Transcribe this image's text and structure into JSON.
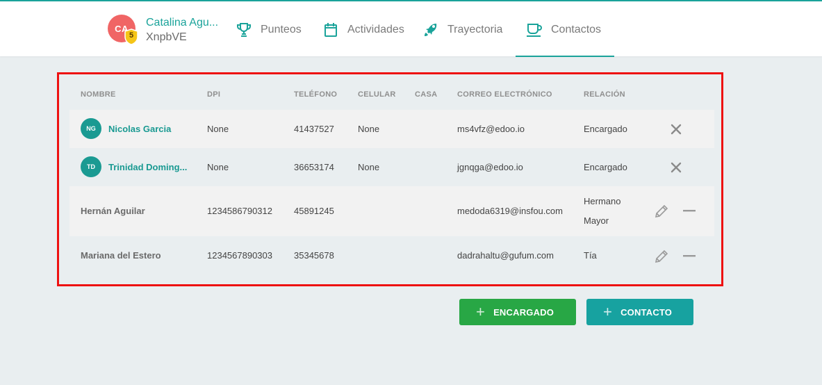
{
  "student": {
    "initials": "CA",
    "level": "5",
    "name": "Catalina Agu...",
    "code": "XnpbVE"
  },
  "nav": {
    "tabs": [
      {
        "label": "Punteos",
        "icon": "trophy-icon"
      },
      {
        "label": "Actividades",
        "icon": "calendar-icon"
      },
      {
        "label": "Trayectoria",
        "icon": "rocket-icon"
      },
      {
        "label": "Contactos",
        "icon": "cup-icon",
        "active": true
      }
    ]
  },
  "table": {
    "headers": [
      "NOMBRE",
      "DPI",
      "TELÉFONO",
      "CELULAR",
      "CASA",
      "CORREO ELECTRÓNICO",
      "RELACIÓN"
    ],
    "rows": [
      {
        "initials": "NG",
        "name": "Nicolas Garcia",
        "dpi": "None",
        "telefono": "41437527",
        "celular": "None",
        "casa": "",
        "correo": "ms4vfz@edoo.io",
        "relacion": "Encargado",
        "relacion_line2": "",
        "actions": [
          "close-icon"
        ]
      },
      {
        "initials": "TD",
        "name": "Trinidad Doming...",
        "dpi": "None",
        "telefono": "36653174",
        "celular": "None",
        "casa": "",
        "correo": "jgnqga@edoo.io",
        "relacion": "Encargado",
        "relacion_line2": "",
        "actions": [
          "close-icon"
        ]
      },
      {
        "initials": "",
        "name": "Hernán Aguilar",
        "dpi": "1234586790312",
        "telefono": "45891245",
        "celular": "",
        "casa": "",
        "correo": "medoda6319@insfou.com",
        "relacion": "Hermano",
        "relacion_line2": "Mayor",
        "actions": [
          "pencil-icon",
          "minus-icon"
        ]
      },
      {
        "initials": "",
        "name": "Mariana del Estero",
        "dpi": "1234567890303",
        "telefono": "35345678",
        "celular": "",
        "casa": "",
        "correo": "dadrahaltu@gufum.com",
        "relacion": "Tía",
        "relacion_line2": "",
        "actions": [
          "pencil-icon",
          "minus-icon"
        ]
      }
    ]
  },
  "buttons": {
    "encargado": "ENCARGADO",
    "contacto": "CONTACTO"
  },
  "colors": {
    "accent": "#1aa39a",
    "highlight_border": "#ee1111",
    "green_button": "#28a745",
    "teal_button": "#17a2a0",
    "avatar": "#f06565"
  }
}
